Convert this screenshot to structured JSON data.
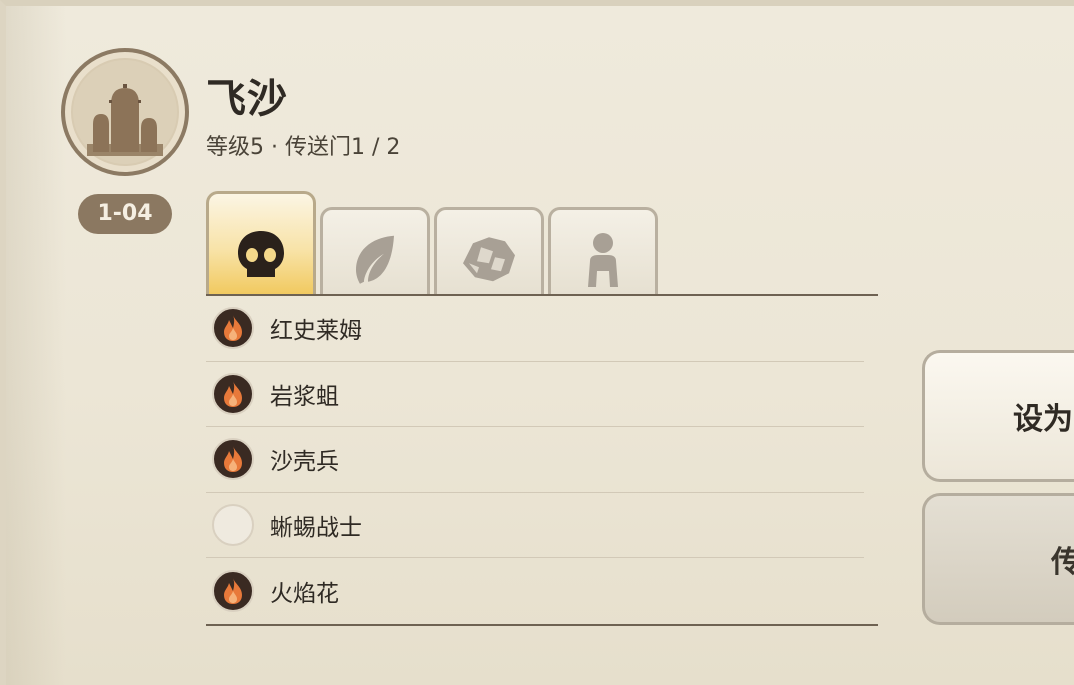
{
  "location": {
    "name": "飞沙",
    "subtitle": "等级5 · 传送门1 / 2",
    "stage_code": "1-04",
    "icon": "desert-cactus-emblem"
  },
  "tabs": [
    {
      "icon": "skull-icon",
      "active": true
    },
    {
      "icon": "leaf-icon",
      "active": false
    },
    {
      "icon": "ore-rock-icon",
      "active": false
    },
    {
      "icon": "person-icon",
      "active": false
    }
  ],
  "monsters": [
    {
      "name": "红史莱姆",
      "icon": "fire-icon",
      "discovered": true
    },
    {
      "name": "岩浆蛆",
      "icon": "fire-icon",
      "discovered": true
    },
    {
      "name": "沙壳兵",
      "icon": "fire-icon",
      "discovered": true
    },
    {
      "name": "蜥蜴战士",
      "icon": "empty-circle",
      "discovered": false
    },
    {
      "name": "火焰花",
      "icon": "fire-icon",
      "discovered": true
    }
  ],
  "buttons": {
    "primary_label": "设为",
    "secondary_label": "传"
  },
  "colors": {
    "panel_bg": "#ece6d6",
    "active_tab": "#f1c95e",
    "badge_bg": "#8b7861",
    "fire_orange": "#e8793a"
  }
}
